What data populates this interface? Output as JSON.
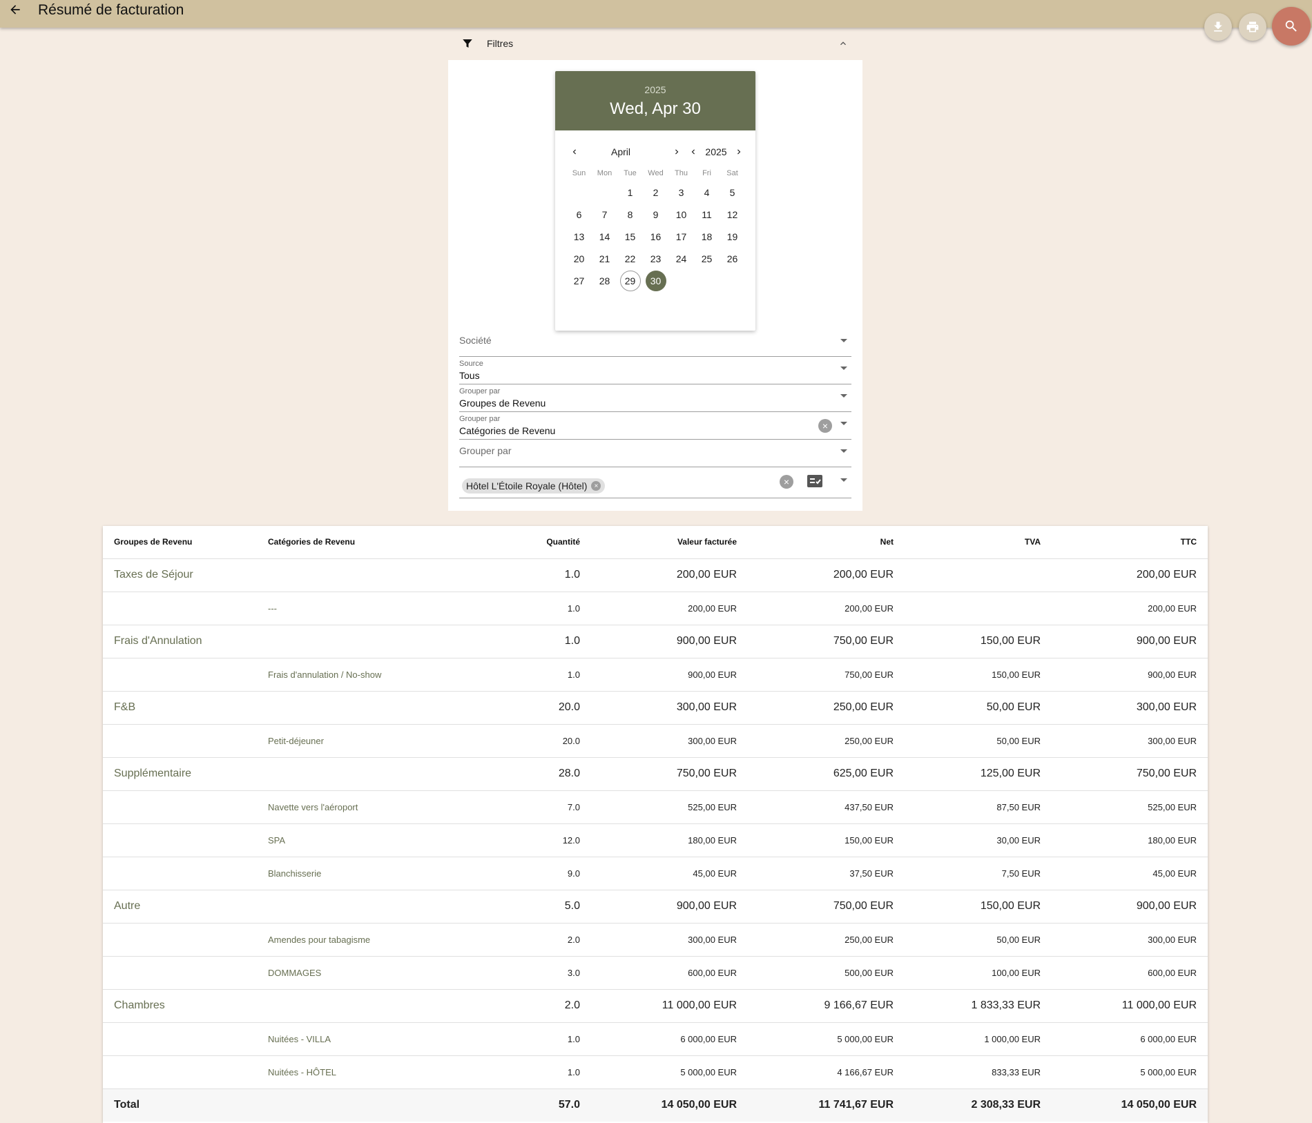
{
  "header": {
    "title": "Résumé de facturation"
  },
  "filters": {
    "label": "Filtres",
    "datepicker": {
      "year": "2025",
      "selected_label": "Wed, Apr 30",
      "month": "April",
      "nav_year": "2025",
      "weekdays": [
        "Sun",
        "Mon",
        "Tue",
        "Wed",
        "Thu",
        "Fri",
        "Sat"
      ],
      "leading_blanks": 2,
      "days_in_month": 30,
      "today": 29,
      "selected": 30
    },
    "fields": {
      "societe": {
        "label": "Société"
      },
      "source": {
        "label": "Source",
        "value": "Tous"
      },
      "group1": {
        "label": "Grouper par",
        "value": "Groupes de Revenu"
      },
      "group2": {
        "label": "Grouper par",
        "value": "Catégories de Revenu"
      },
      "group3": {
        "label": "Grouper par"
      },
      "property_chip": "Hôtel L'Étoile Royale (Hôtel)"
    }
  },
  "table": {
    "columns": [
      "Groupes de Revenu",
      "Catégories de Revenu",
      "Quantité",
      "Valeur facturée",
      "Net",
      "TVA",
      "TTC"
    ],
    "rows": [
      {
        "type": "group",
        "cells": [
          "Taxes de Séjour",
          "",
          "1.0",
          "200,00 EUR",
          "200,00 EUR",
          "",
          "200,00 EUR"
        ]
      },
      {
        "type": "sub",
        "cells": [
          "",
          "---",
          "1.0",
          "200,00 EUR",
          "200,00 EUR",
          "",
          "200,00 EUR"
        ]
      },
      {
        "type": "group",
        "cells": [
          "Frais d'Annulation",
          "",
          "1.0",
          "900,00 EUR",
          "750,00 EUR",
          "150,00 EUR",
          "900,00 EUR"
        ]
      },
      {
        "type": "sub",
        "cells": [
          "",
          "Frais d'annulation / No-show",
          "1.0",
          "900,00 EUR",
          "750,00 EUR",
          "150,00 EUR",
          "900,00 EUR"
        ]
      },
      {
        "type": "group",
        "cells": [
          "F&B",
          "",
          "20.0",
          "300,00 EUR",
          "250,00 EUR",
          "50,00 EUR",
          "300,00 EUR"
        ]
      },
      {
        "type": "sub",
        "cells": [
          "",
          "Petit-déjeuner",
          "20.0",
          "300,00 EUR",
          "250,00 EUR",
          "50,00 EUR",
          "300,00 EUR"
        ]
      },
      {
        "type": "group",
        "cells": [
          "Supplémentaire",
          "",
          "28.0",
          "750,00 EUR",
          "625,00 EUR",
          "125,00 EUR",
          "750,00 EUR"
        ]
      },
      {
        "type": "sub",
        "cells": [
          "",
          "Navette vers l'aéroport",
          "7.0",
          "525,00 EUR",
          "437,50 EUR",
          "87,50 EUR",
          "525,00 EUR"
        ]
      },
      {
        "type": "sub",
        "cells": [
          "",
          "SPA",
          "12.0",
          "180,00 EUR",
          "150,00 EUR",
          "30,00 EUR",
          "180,00 EUR"
        ]
      },
      {
        "type": "sub",
        "cells": [
          "",
          "Blanchisserie",
          "9.0",
          "45,00 EUR",
          "37,50 EUR",
          "7,50 EUR",
          "45,00 EUR"
        ]
      },
      {
        "type": "group",
        "cells": [
          "Autre",
          "",
          "5.0",
          "900,00 EUR",
          "750,00 EUR",
          "150,00 EUR",
          "900,00 EUR"
        ]
      },
      {
        "type": "sub",
        "cells": [
          "",
          "Amendes pour tabagisme",
          "2.0",
          "300,00 EUR",
          "250,00 EUR",
          "50,00 EUR",
          "300,00 EUR"
        ]
      },
      {
        "type": "sub",
        "cells": [
          "",
          "DOMMAGES",
          "3.0",
          "600,00 EUR",
          "500,00 EUR",
          "100,00 EUR",
          "600,00 EUR"
        ]
      },
      {
        "type": "group",
        "cells": [
          "Chambres",
          "",
          "2.0",
          "11 000,00 EUR",
          "9 166,67 EUR",
          "1 833,33 EUR",
          "11 000,00 EUR"
        ]
      },
      {
        "type": "sub",
        "cells": [
          "",
          "Nuitées - VILLA",
          "1.0",
          "6 000,00 EUR",
          "5 000,00 EUR",
          "1 000,00 EUR",
          "6 000,00 EUR"
        ]
      },
      {
        "type": "sub",
        "cells": [
          "",
          "Nuitées - HÔTEL",
          "1.0",
          "5 000,00 EUR",
          "4 166,67 EUR",
          "833,33 EUR",
          "5 000,00 EUR"
        ]
      }
    ],
    "total": [
      "Total",
      "",
      "57.0",
      "14 050,00 EUR",
      "11 741,67 EUR",
      "2 308,33 EUR",
      "14 050,00 EUR"
    ]
  },
  "colors": {
    "accent": "#676f52",
    "topbar": "#d0c19f",
    "search_fab": "#c87865",
    "background": "#f5ece3"
  },
  "icons": [
    "back-arrow-icon",
    "download-icon",
    "print-icon",
    "search-icon",
    "filter-icon",
    "chevron-up-icon",
    "chevron-left-icon",
    "chevron-right-icon",
    "clear-icon",
    "checklist-icon",
    "dropdown-arrow-icon"
  ]
}
